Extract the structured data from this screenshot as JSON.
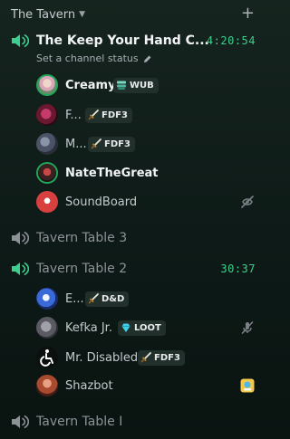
{
  "category": {
    "name": "The Tavern"
  },
  "channels": [
    {
      "name": "The Keep Your Hand C...",
      "timer": "4:20:54",
      "status": "Set a channel status"
    },
    {
      "name": "Tavern Table 3"
    },
    {
      "name": "Tavern Table 2",
      "timer": "30:37"
    },
    {
      "name": "Tavern Table I"
    }
  ],
  "users": [
    {
      "name": "Creamy",
      "tag": "WUB"
    },
    {
      "name": "F...",
      "tag": "FDF3"
    },
    {
      "name": "M...",
      "tag": "FDF3"
    },
    {
      "name": "NateTheGreat"
    },
    {
      "name": "SoundBoard"
    },
    {
      "name": "E...",
      "tag": "D&D"
    },
    {
      "name": "Kefka Jr.",
      "tag": "LOOT"
    },
    {
      "name": "Mr. Disabled",
      "tag": "FDF3"
    },
    {
      "name": "Shazbot"
    }
  ],
  "colors": {
    "accent_green": "#23a55a",
    "timer_green": "#3ecf8e"
  }
}
